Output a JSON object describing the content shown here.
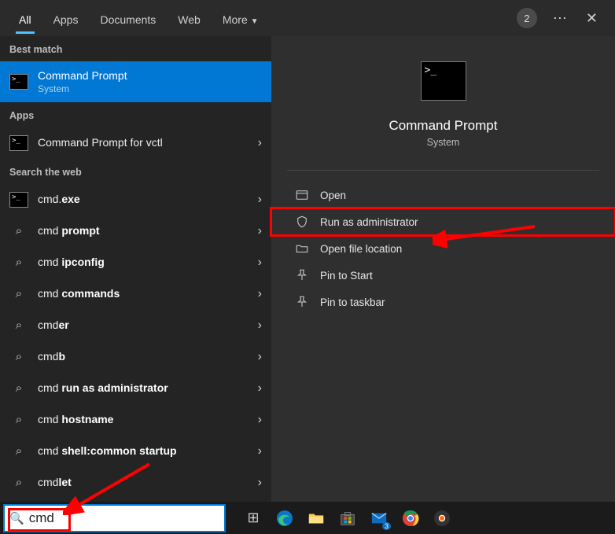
{
  "tabs": {
    "all": "All",
    "apps": "Apps",
    "documents": "Documents",
    "web": "Web",
    "more": "More"
  },
  "header": {
    "badge": "2"
  },
  "sections": {
    "best": "Best match",
    "apps": "Apps",
    "web": "Search the web"
  },
  "best_match": {
    "title": "Command Prompt",
    "sub": "System"
  },
  "apps_results": [
    {
      "title_pre": "Command Prompt for vc",
      "title_bold": "",
      "title_post": "tl"
    }
  ],
  "web_results": [
    {
      "pre": "cmd.",
      "bold": "exe",
      "post": "",
      "icon": "cmd"
    },
    {
      "pre": "cmd ",
      "bold": "prompt",
      "post": "",
      "icon": "search"
    },
    {
      "pre": "cmd ",
      "bold": "ipconfig",
      "post": "",
      "icon": "search"
    },
    {
      "pre": "cmd ",
      "bold": "commands",
      "post": "",
      "icon": "search"
    },
    {
      "pre": "cmd",
      "bold": "er",
      "post": "",
      "icon": "search"
    },
    {
      "pre": "cmd",
      "bold": "b",
      "post": "",
      "icon": "search"
    },
    {
      "pre": "cmd ",
      "bold": "run as administrator",
      "post": "",
      "icon": "search"
    },
    {
      "pre": "cmd ",
      "bold": "hostname",
      "post": "",
      "icon": "search"
    },
    {
      "pre": "cmd ",
      "bold": "shell:common startup",
      "post": "",
      "icon": "search"
    },
    {
      "pre": "cmd",
      "bold": "let",
      "post": "",
      "icon": "search"
    }
  ],
  "preview": {
    "title": "Command Prompt",
    "sub": "System"
  },
  "actions": {
    "open": "Open",
    "run_admin": "Run as administrator",
    "open_loc": "Open file location",
    "pin_start": "Pin to Start",
    "pin_task": "Pin to taskbar"
  },
  "search": {
    "value": "cmd"
  },
  "taskbar_icons": [
    "task-view",
    "edge",
    "file-explorer",
    "ms-store",
    "mail",
    "chrome",
    "chrome-canary"
  ]
}
